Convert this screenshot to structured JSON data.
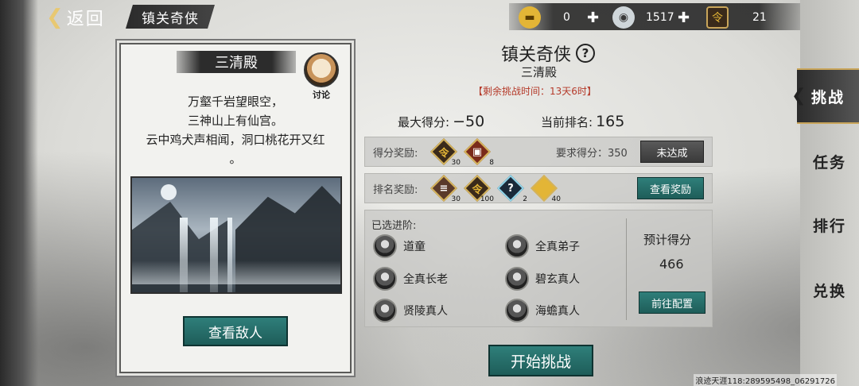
{
  "header": {
    "back_label": "返回",
    "mode_title": "镇关奇侠"
  },
  "resources": [
    {
      "icon": "gold-ingot-icon",
      "value": "0"
    },
    {
      "icon": "silver-ingot-icon",
      "value": "1517"
    },
    {
      "icon": "token-icon",
      "value": "21"
    }
  ],
  "card": {
    "title": "三清殿",
    "discuss_label": "讨论",
    "poem": [
      "万壑千岩望眼空，",
      "三神山上有仙宫。",
      "云中鸡犬声相闻，洞口桃花开又红",
      "。"
    ],
    "view_enemy_label": "查看敌人"
  },
  "event": {
    "title": "镇关奇侠",
    "subtitle": "三清殿",
    "time_left": "【剩余挑战时间：13天6时】",
    "max_score_label": "最大得分:",
    "max_score_value": "−50",
    "rank_label": "当前排名:",
    "rank_value": "165"
  },
  "score_reward": {
    "label": "得分奖励:",
    "items": [
      {
        "icon": "token-icon",
        "count": "30"
      },
      {
        "icon": "chest-icon",
        "count": "8"
      }
    ],
    "requirement": "要求得分：350",
    "status_label": "未达成"
  },
  "rank_reward": {
    "label": "排名奖励:",
    "items": [
      {
        "icon": "scroll-icon",
        "count": "30"
      },
      {
        "icon": "token-icon",
        "count": "100"
      },
      {
        "icon": "mystery-box-icon",
        "count": "2"
      },
      {
        "icon": "gold-ingot-icon",
        "count": "40"
      }
    ],
    "view_label": "查看奖励"
  },
  "team": {
    "label": "已选进阶:",
    "heroes": [
      "道童",
      "全真弟子",
      "全真长老",
      "碧玄真人",
      "贤陵真人",
      "海蟾真人"
    ],
    "estimate_label": "预计得分",
    "estimate_value": "466",
    "config_label": "前往配置"
  },
  "start_label": "开始挑战",
  "tabs": [
    "挑战",
    "任务",
    "排行",
    "兑换"
  ],
  "watermark": "浪迹天涯118:289595498_06291726"
}
